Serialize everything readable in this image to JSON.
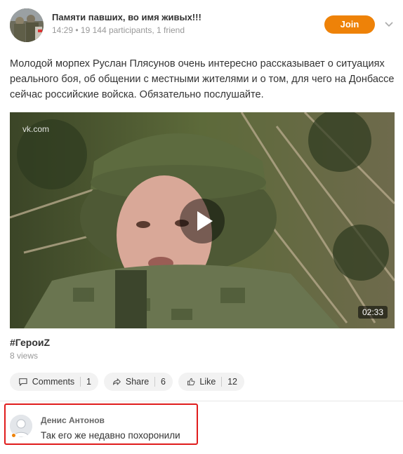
{
  "group": {
    "name": "Памяти павших, во имя живых!!!",
    "time": "14:29",
    "participants": "19 144 participants",
    "friends": "1 friend",
    "join_label": "Join"
  },
  "post": {
    "text": "Молодой морпех Руслан Плясунов очень интересно рассказывает о ситуациях реального боя, об общении с местными жителями и о том, для чего на Донбассе сейчас российские войска. Обязательно послушайте."
  },
  "video": {
    "watermark": "vk.com",
    "duration": "02:33"
  },
  "media": {
    "title": "#ГероиZ",
    "views": "8 views"
  },
  "actions": {
    "comments_label": "Comments",
    "comments_count": "1",
    "share_label": "Share",
    "share_count": "6",
    "like_label": "Like",
    "like_count": "12"
  },
  "comment": {
    "author": "Денис Антонов",
    "text": "Так его же недавно похоронили"
  },
  "colors": {
    "accent": "#ee8208",
    "highlight_border": "#e01c1c"
  }
}
